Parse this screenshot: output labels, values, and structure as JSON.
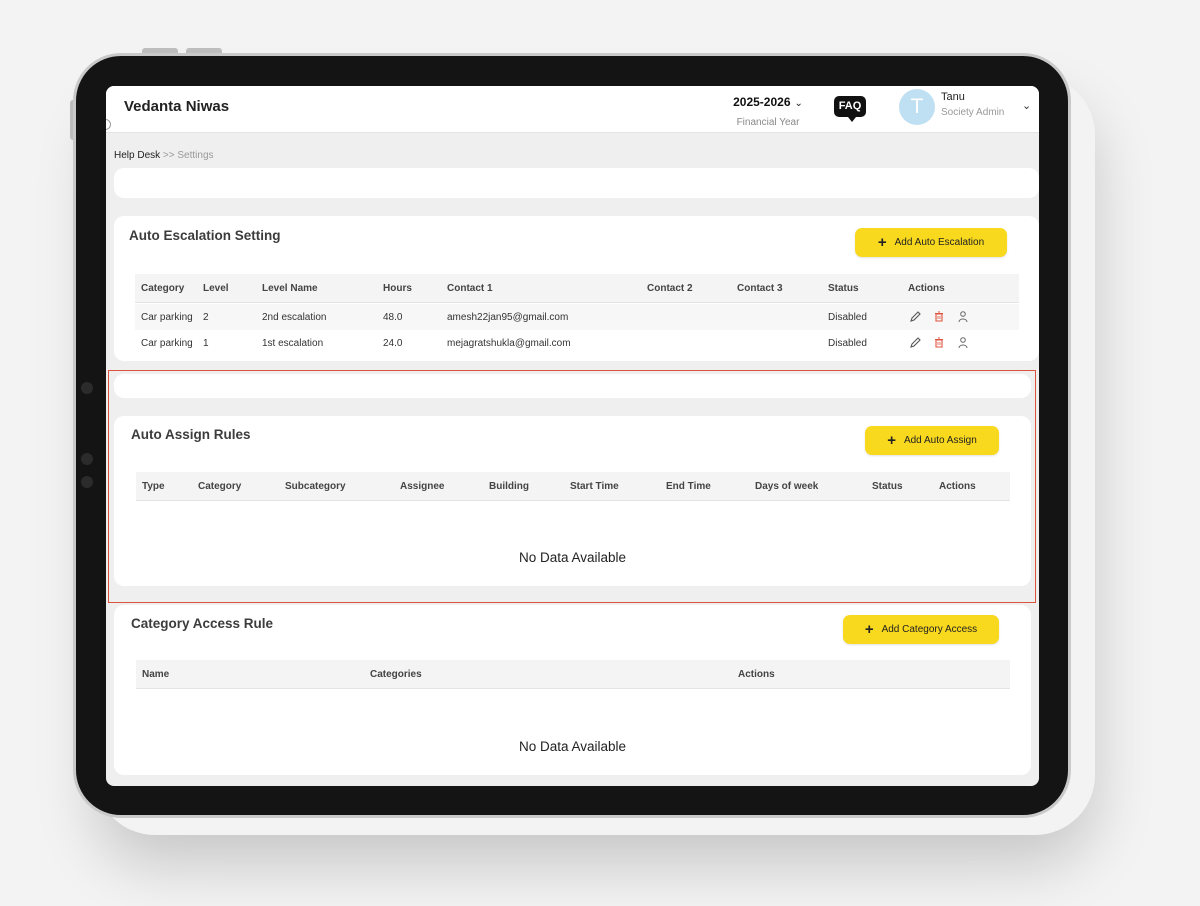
{
  "header": {
    "title": "Vedanta Niwas",
    "financial_year": "2025-2026",
    "financial_year_label": "Financial Year",
    "faq_label": "FAQ",
    "user_initial": "T",
    "user_name": "Tanu",
    "user_role": "Society Admin"
  },
  "breadcrumb": {
    "root": "Help Desk",
    "separator": ">>",
    "current": "Settings"
  },
  "escalation": {
    "title": "Auto Escalation Setting",
    "add_button": "Add Auto Escalation",
    "columns": [
      "Category",
      "Level",
      "Level Name",
      "Hours",
      "Contact 1",
      "Contact 2",
      "Contact 3",
      "Status",
      "Actions"
    ],
    "rows": [
      {
        "category": "Car parking",
        "level": "2",
        "level_name": "2nd escalation",
        "hours": "48.0",
        "contact1": "amesh22jan95@gmail.com",
        "contact2": "",
        "contact3": "",
        "status": "Disabled"
      },
      {
        "category": "Car parking",
        "level": "1",
        "level_name": "1st escalation",
        "hours": "24.0",
        "contact1": "mejagratshukla@gmail.com",
        "contact2": "",
        "contact3": "",
        "status": "Disabled"
      }
    ]
  },
  "assign": {
    "title": "Auto Assign Rules",
    "add_button": "Add Auto Assign",
    "columns": [
      "Type",
      "Category",
      "Subcategory",
      "Assignee",
      "Building",
      "Start Time",
      "End Time",
      "Days of week",
      "Status",
      "Actions"
    ],
    "empty": "No Data Available"
  },
  "access": {
    "title": "Category Access Rule",
    "add_button": "Add Category Access",
    "columns": [
      "Name",
      "Categories",
      "Actions"
    ],
    "empty": "No Data Available"
  },
  "colors": {
    "accent": "#f8d91e",
    "highlight": "#d9533d",
    "avatar": "#bfe0f3",
    "delete": "#e0533d"
  },
  "icons": {
    "edit": "pencil-icon",
    "delete": "trash-icon",
    "user": "user-icon",
    "caret": "chevron-down-icon"
  }
}
